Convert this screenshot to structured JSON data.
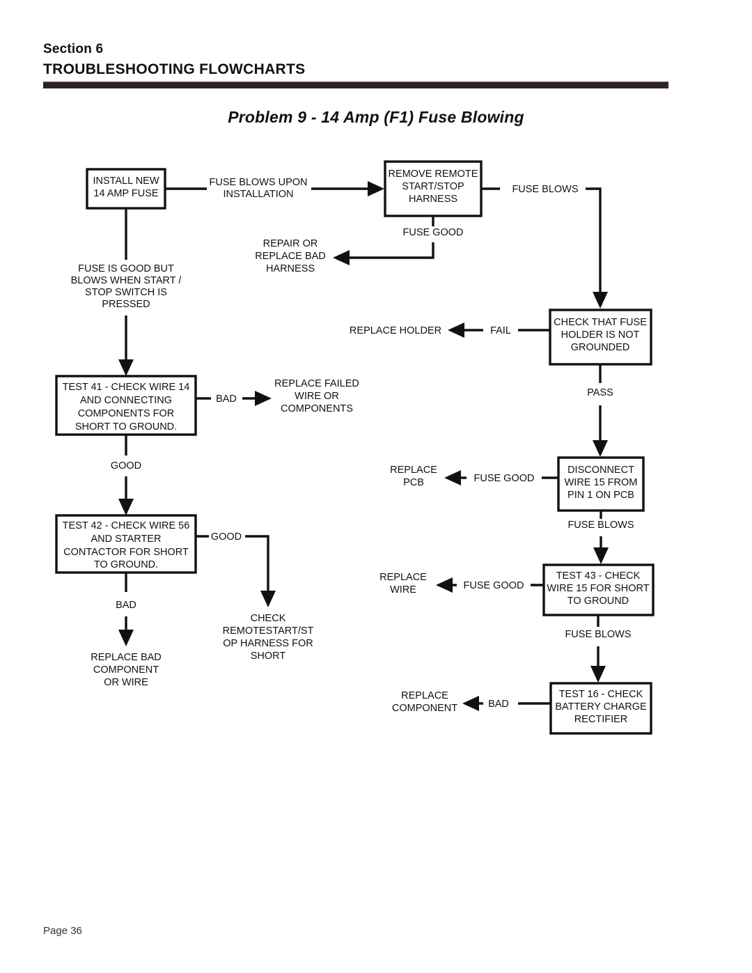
{
  "header": {
    "section_label": "Section  6",
    "section_title": "TROUBLESHOOTING FLOWCHARTS",
    "rule_color": "#2b2422"
  },
  "problem": {
    "title": "Problem 9 - 14 Amp (F1) Fuse Blowing"
  },
  "footer": {
    "page_label": "Page 36"
  },
  "flowchart": {
    "boxes": {
      "install_fuse": {
        "lines": [
          "INSTALL NEW",
          "14 AMP FUSE"
        ]
      },
      "remove_harness": {
        "lines": [
          "REMOVE REMOTE",
          "START/STOP",
          "HARNESS"
        ]
      },
      "check_holder": {
        "lines": [
          "CHECK THAT FUSE",
          "HOLDER IS NOT",
          "GROUNDED"
        ]
      },
      "test41": {
        "lines": [
          "TEST 41 - CHECK WIRE 14",
          "AND CONNECTING",
          "COMPONENTS  FOR",
          "SHORT TO GROUND."
        ]
      },
      "disconnect_wire15": {
        "lines": [
          "DISCONNECT",
          "WIRE 15 FROM",
          "PIN 1 ON PCB"
        ]
      },
      "test42": {
        "lines": [
          "TEST 42 - CHECK WIRE 56",
          "AND STARTER",
          "CONTACTOR FOR SHORT",
          "TO GROUND."
        ]
      },
      "test43": {
        "lines": [
          "TEST 43 - CHECK",
          "WIRE 15 FOR SHORT",
          "TO GROUND"
        ]
      },
      "test16": {
        "lines": [
          "TEST 16 - CHECK",
          "BATTERY CHARGE",
          "RECTIFIER"
        ]
      }
    },
    "terminals": {
      "repair_harness": {
        "lines": [
          "REPAIR OR",
          "REPLACE BAD",
          "HARNESS"
        ]
      },
      "fuse_good_but": {
        "lines": [
          "FUSE IS GOOD BUT",
          "BLOWS WHEN START /",
          "STOP SWITCH IS",
          "PRESSED"
        ]
      },
      "replace_holder": {
        "lines": [
          "REPLACE HOLDER"
        ]
      },
      "replace_failed": {
        "lines": [
          "REPLACE FAILED",
          "WIRE OR",
          "COMPONENTS"
        ]
      },
      "replace_pcb": {
        "lines": [
          "REPLACE",
          "PCB"
        ]
      },
      "replace_wire": {
        "lines": [
          "REPLACE",
          "WIRE"
        ]
      },
      "replace_component": {
        "lines": [
          "REPLACE",
          "COMPONENT"
        ]
      },
      "replace_bad_component": {
        "lines": [
          "REPLACE BAD",
          "COMPONENT",
          "OR WIRE"
        ]
      },
      "check_remote_harness": {
        "lines": [
          "CHECK",
          "REMOTESTART/ST",
          "OP  HARNESS FOR",
          "SHORT"
        ]
      }
    },
    "edge_labels": {
      "fuse_blows_upon_installation": {
        "lines": [
          "FUSE BLOWS UPON",
          "INSTALLATION"
        ]
      },
      "fuse_blows_1": "FUSE BLOWS",
      "fuse_good_1": "FUSE GOOD",
      "fail": "FAIL",
      "pass": "PASS",
      "bad_41": "BAD",
      "good_41": "GOOD",
      "fuse_good_pcb": "FUSE GOOD",
      "fuse_blows_2": "FUSE BLOWS",
      "good_42": "GOOD",
      "bad_42": "BAD",
      "fuse_good_43": "FUSE GOOD",
      "fuse_blows_3": "FUSE BLOWS",
      "bad_16": "BAD"
    }
  }
}
